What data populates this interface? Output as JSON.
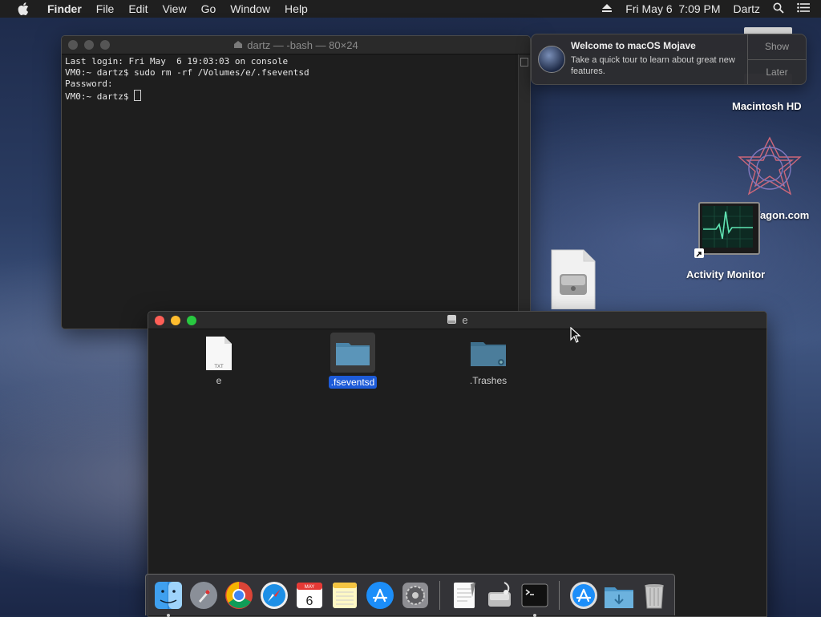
{
  "menubar": {
    "app_name": "Finder",
    "items": [
      "File",
      "Edit",
      "View",
      "Go",
      "Window",
      "Help"
    ],
    "datetime": "Fri May 6  7:09 PM",
    "user": "Dartz",
    "icons": [
      "apple-icon",
      "eject-icon",
      "search-icon",
      "notification-center-icon"
    ]
  },
  "terminal": {
    "title": "dartz — -bash — 80×24",
    "lines": [
      "Last login: Fri May  6 19:03:03 on console",
      "VM0:~ dartz$ sudo rm -rf /Volumes/e/.fseventsd",
      "Password:",
      "VM0:~ dartz$ "
    ]
  },
  "notification": {
    "title": "Welcome to macOS Mojave",
    "text": "Take a quick tour to learn about great new features.",
    "show_label": "Show",
    "later_label": "Later"
  },
  "desktop": {
    "macintosh_hd": "Macintosh HD",
    "wagon": "Vagon.com",
    "activity_monitor": "Activity Monitor"
  },
  "finder": {
    "title": "e",
    "items": [
      {
        "name": "e",
        "kind": "txt-file",
        "badge": "TXT"
      },
      {
        "name": ".fseventsd",
        "kind": "folder",
        "selected": true
      },
      {
        "name": ".Trashes",
        "kind": "folder-badged"
      }
    ]
  },
  "calendar": {
    "month": "MAY",
    "day": "6"
  },
  "dock": {
    "apps": [
      "Finder",
      "Launchpad",
      "Google Chrome",
      "Safari",
      "Calendar",
      "Notes",
      "App Store",
      "System Preferences",
      "TextEdit",
      "Disk Utility",
      "Terminal",
      "App Store",
      "Downloads",
      "Trash"
    ]
  },
  "colors": {
    "selection": "#1d5bd8",
    "menubar": "#1f1f1f",
    "window": "#1e1e1e"
  }
}
